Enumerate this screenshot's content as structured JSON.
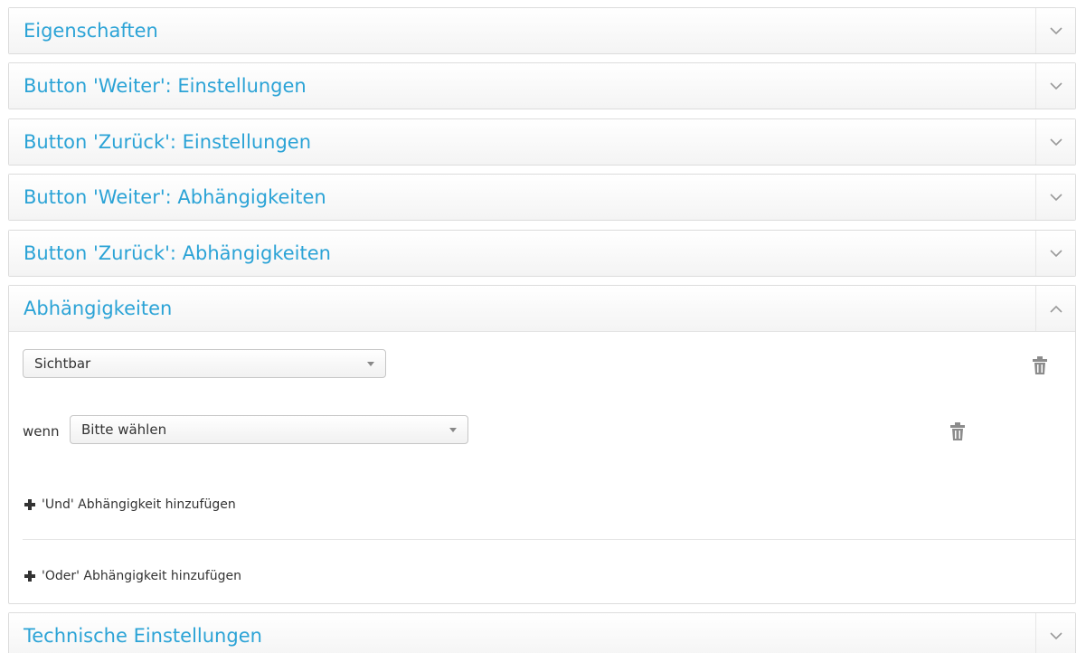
{
  "panels": [
    {
      "title": "Eigenschaften",
      "state": "collapsed",
      "toggle_icon": "chevron-down-icon"
    },
    {
      "title": "Button 'Weiter': Einstellungen",
      "state": "collapsed",
      "toggle_icon": "chevron-down-icon"
    },
    {
      "title": "Button 'Zurück': Einstellungen",
      "state": "collapsed",
      "toggle_icon": "chevron-down-icon"
    },
    {
      "title": "Button 'Weiter': Abhängigkeiten",
      "state": "collapsed",
      "toggle_icon": "chevron-down-icon"
    },
    {
      "title": "Button 'Zurück': Abhängigkeiten",
      "state": "collapsed",
      "toggle_icon": "chevron-down-icon"
    },
    {
      "title": "Abhängigkeiten",
      "state": "expanded",
      "toggle_icon": "chevron-up-icon"
    },
    {
      "title": "Technische Einstellungen",
      "state": "collapsed",
      "toggle_icon": "chevron-down-icon"
    }
  ],
  "dependencies": {
    "action_select": {
      "value": "Sichtbar"
    },
    "condition_label": "wenn",
    "condition_select": {
      "value": "Bitte wählen"
    },
    "add_and_label": "'Und' Abhängigkeit hinzufügen",
    "add_or_label": "'Oder' Abhängigkeit hinzufügen",
    "delete_icon": "trash-icon",
    "add_icon": "plus-icon"
  },
  "colors": {
    "title": "#2ba3d6",
    "text": "#333333",
    "icon": "#8c8c8c",
    "border": "#dcdcdc"
  }
}
